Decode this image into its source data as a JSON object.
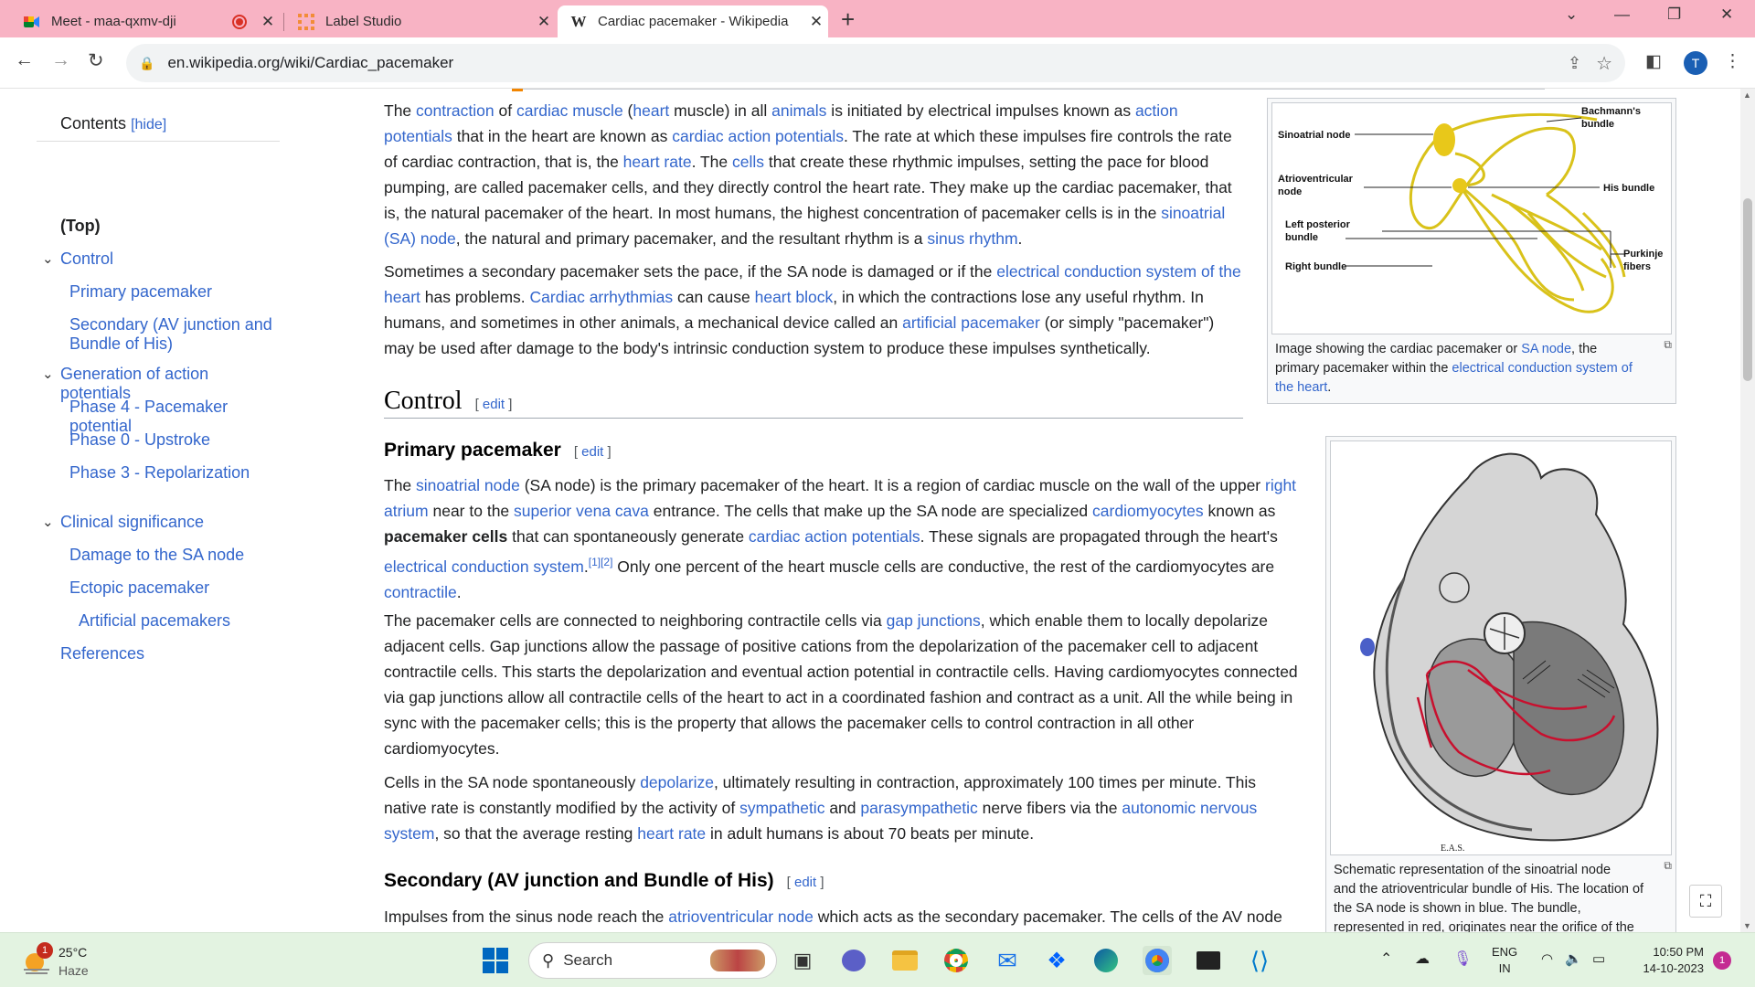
{
  "browser": {
    "tabs": [
      {
        "title": "Meet - maa-qxmv-dji",
        "favicon": "google-meet-icon",
        "recording": true
      },
      {
        "title": "Label Studio",
        "favicon": "label-studio-icon"
      },
      {
        "title": "Cardiac pacemaker - Wikipedia",
        "favicon": "wikipedia-icon",
        "active": true
      }
    ],
    "url": "en.wikipedia.org/wiki/Cardiac_pacemaker",
    "profile_initial": "T"
  },
  "toc": {
    "title": "Contents",
    "hide": "[hide]",
    "items": [
      {
        "label": "(Top)",
        "level": 0,
        "bold": true
      },
      {
        "label": "Control",
        "level": 0,
        "expandable": true
      },
      {
        "label": "Primary pacemaker",
        "level": 1
      },
      {
        "label": "Secondary (AV junction and Bundle of His)",
        "level": 1
      },
      {
        "label": "Generation of action potentials",
        "level": 0,
        "expandable": true
      },
      {
        "label": "Phase 4 - Pacemaker potential",
        "level": 1
      },
      {
        "label": "Phase 0 - Upstroke",
        "level": 1
      },
      {
        "label": "Phase 3 - Repolarization",
        "level": 1
      },
      {
        "label": "Clinical significance",
        "level": 0,
        "expandable": true
      },
      {
        "label": "Damage to the SA node",
        "level": 1
      },
      {
        "label": "Ectopic pacemaker",
        "level": 1
      },
      {
        "label": "Artificial pacemakers",
        "level": 2
      },
      {
        "label": "References",
        "level": 0
      }
    ]
  },
  "article": {
    "intro1": [
      [
        "t",
        "The "
      ],
      [
        "l",
        "contraction"
      ],
      [
        "t",
        " of "
      ],
      [
        "l",
        "cardiac muscle"
      ],
      [
        "t",
        " ("
      ],
      [
        "l",
        "heart"
      ],
      [
        "t",
        " muscle) in all "
      ],
      [
        "l",
        "animals"
      ],
      [
        "t",
        " is initiated by electrical impulses known as "
      ],
      [
        "l",
        "action"
      ],
      [
        "br",
        ""
      ],
      [
        "l",
        "potentials"
      ],
      [
        "t",
        " that in the heart are known as "
      ],
      [
        "l",
        "cardiac action potentials"
      ],
      [
        "t",
        ". The rate at which these impulses fire controls the rate"
      ],
      [
        "br",
        ""
      ],
      [
        "t",
        "of cardiac contraction, that is, the "
      ],
      [
        "l",
        "heart rate"
      ],
      [
        "t",
        ". The "
      ],
      [
        "l",
        "cells"
      ],
      [
        "t",
        " that create these rhythmic impulses, setting the pace for blood"
      ],
      [
        "br",
        ""
      ],
      [
        "t",
        "pumping, are called pacemaker cells, and they directly control the heart rate. They make up the cardiac pacemaker, that"
      ],
      [
        "br",
        ""
      ],
      [
        "t",
        "is, the natural pacemaker of the heart. In most humans, the highest concentration of pacemaker cells is in the "
      ],
      [
        "l",
        "sinoatrial"
      ],
      [
        "br",
        ""
      ],
      [
        "l",
        "(SA) node"
      ],
      [
        "t",
        ", the natural and primary pacemaker, and the resultant rhythm is a "
      ],
      [
        "l",
        "sinus rhythm"
      ],
      [
        "t",
        "."
      ]
    ],
    "intro2": [
      [
        "t",
        "Sometimes a secondary pacemaker sets the pace, if the SA node is damaged or if the "
      ],
      [
        "l",
        "electrical conduction system of the"
      ],
      [
        "br",
        ""
      ],
      [
        "l",
        "heart"
      ],
      [
        "t",
        " has problems. "
      ],
      [
        "l",
        "Cardiac arrhythmias"
      ],
      [
        "t",
        " can cause "
      ],
      [
        "l",
        "heart block"
      ],
      [
        "t",
        ", in which the contractions lose any useful rhythm. In"
      ],
      [
        "br",
        ""
      ],
      [
        "t",
        "humans, and sometimes in other animals, a mechanical device called an "
      ],
      [
        "l",
        "artificial pacemaker"
      ],
      [
        "t",
        " (or simply \"pacemaker\")"
      ],
      [
        "br",
        ""
      ],
      [
        "t",
        "may be used after damage to the body's intrinsic conduction system to produce these impulses synthetically."
      ]
    ],
    "h2_control": "Control",
    "edit_label": "edit",
    "h3_primary": "Primary pacemaker",
    "primary1": [
      [
        "t",
        "The "
      ],
      [
        "l",
        "sinoatrial node"
      ],
      [
        "t",
        " (SA node) is the primary pacemaker of the heart. It is a region of cardiac muscle on the wall of the upper "
      ],
      [
        "l",
        "right"
      ],
      [
        "br",
        ""
      ],
      [
        "l",
        "atrium"
      ],
      [
        "t",
        " near to the "
      ],
      [
        "l",
        "superior vena cava"
      ],
      [
        "t",
        " entrance. The cells that make up the SA node are specialized "
      ],
      [
        "l",
        "cardiomyocytes"
      ],
      [
        "t",
        " known as"
      ],
      [
        "br",
        ""
      ],
      [
        "b",
        "pacemaker cells"
      ],
      [
        "t",
        " that can spontaneously generate "
      ],
      [
        "l",
        "cardiac action potentials"
      ],
      [
        "t",
        ". These signals are propagated through the heart's"
      ],
      [
        "br",
        ""
      ],
      [
        "l",
        "electrical conduction system"
      ],
      [
        "t",
        "."
      ],
      [
        "s",
        "[1][2]"
      ],
      [
        "t",
        " Only one percent of the heart muscle cells are conductive, the rest of the cardiomyocytes are"
      ],
      [
        "br",
        ""
      ],
      [
        "l",
        "contractile"
      ],
      [
        "t",
        "."
      ]
    ],
    "primary2": [
      [
        "t",
        "The pacemaker cells are connected to neighboring contractile cells via "
      ],
      [
        "l",
        "gap junctions"
      ],
      [
        "t",
        ", which enable them to locally depolarize"
      ],
      [
        "br",
        ""
      ],
      [
        "t",
        "adjacent cells. Gap junctions allow the passage of positive cations from the depolarization of the pacemaker cell to adjacent"
      ],
      [
        "br",
        ""
      ],
      [
        "t",
        "contractile cells. This starts the depolarization and eventual action potential in contractile cells. Having cardiomyocytes connected"
      ],
      [
        "br",
        ""
      ],
      [
        "t",
        "via gap junctions allow all contractile cells of the heart to act in a coordinated fashion and contract as a unit. All the while being in"
      ],
      [
        "br",
        ""
      ],
      [
        "t",
        "sync with the pacemaker cells; this is the property that allows the pacemaker cells to control contraction in all other"
      ],
      [
        "br",
        ""
      ],
      [
        "t",
        "cardiomyocytes."
      ]
    ],
    "primary3": [
      [
        "t",
        "Cells in the SA node spontaneously "
      ],
      [
        "l",
        "depolarize"
      ],
      [
        "t",
        ", ultimately resulting in contraction, approximately 100 times per minute. This"
      ],
      [
        "br",
        ""
      ],
      [
        "t",
        "native rate is constantly modified by the activity of "
      ],
      [
        "l",
        "sympathetic"
      ],
      [
        "t",
        " and "
      ],
      [
        "l",
        "parasympathetic"
      ],
      [
        "t",
        " nerve fibers via the "
      ],
      [
        "l",
        "autonomic nervous"
      ],
      [
        "br",
        ""
      ],
      [
        "l",
        "system"
      ],
      [
        "t",
        ", so that the average resting "
      ],
      [
        "l",
        "heart rate"
      ],
      [
        "t",
        " in adult humans is about 70 beats per minute."
      ]
    ],
    "h3_secondary": "Secondary (AV junction and Bundle of His)",
    "secondary1": [
      [
        "t",
        "Impulses from the sinus node reach the "
      ],
      [
        "l",
        "atrioventricular node"
      ],
      [
        "t",
        " which acts as the secondary pacemaker. The cells of the AV node"
      ]
    ]
  },
  "figures": {
    "diagram_labels": {
      "sinoatrial": "Sinoatrial node",
      "bachmann": "Bachmann's\nbundle",
      "av": "Atrioventricular\nnode",
      "his": "His bundle",
      "lpb": "Left posterior\nbundle",
      "rb": "Right bundle",
      "purkinje": "Purkinje\nfibers"
    },
    "cap1": [
      [
        "t",
        "Image showing the cardiac pacemaker or "
      ],
      [
        "l",
        "SA node"
      ],
      [
        "t",
        ", the"
      ],
      [
        "br",
        ""
      ],
      [
        "t",
        "primary pacemaker within the "
      ],
      [
        "l",
        "electrical conduction system of"
      ],
      [
        "br",
        ""
      ],
      [
        "l",
        "the heart"
      ],
      [
        "t",
        "."
      ]
    ],
    "heart_initials": "E.A.S.",
    "cap2": [
      [
        "t",
        "Schematic representation of the sinoatrial node"
      ],
      [
        "br",
        ""
      ],
      [
        "t",
        "and the atrioventricular bundle of His. The location of"
      ],
      [
        "br",
        ""
      ],
      [
        "t",
        "the SA node is shown in blue. The bundle,"
      ],
      [
        "br",
        ""
      ],
      [
        "t",
        "represented in red, originates near the orifice of the"
      ]
    ]
  },
  "taskbar": {
    "weather_temp": "25°C",
    "weather_desc": "Haze",
    "weather_badge": "1",
    "search_placeholder": "Search",
    "lang1": "ENG",
    "lang2": "IN",
    "time": "10:50 PM",
    "date": "14-10-2023",
    "notif_count": "1"
  }
}
